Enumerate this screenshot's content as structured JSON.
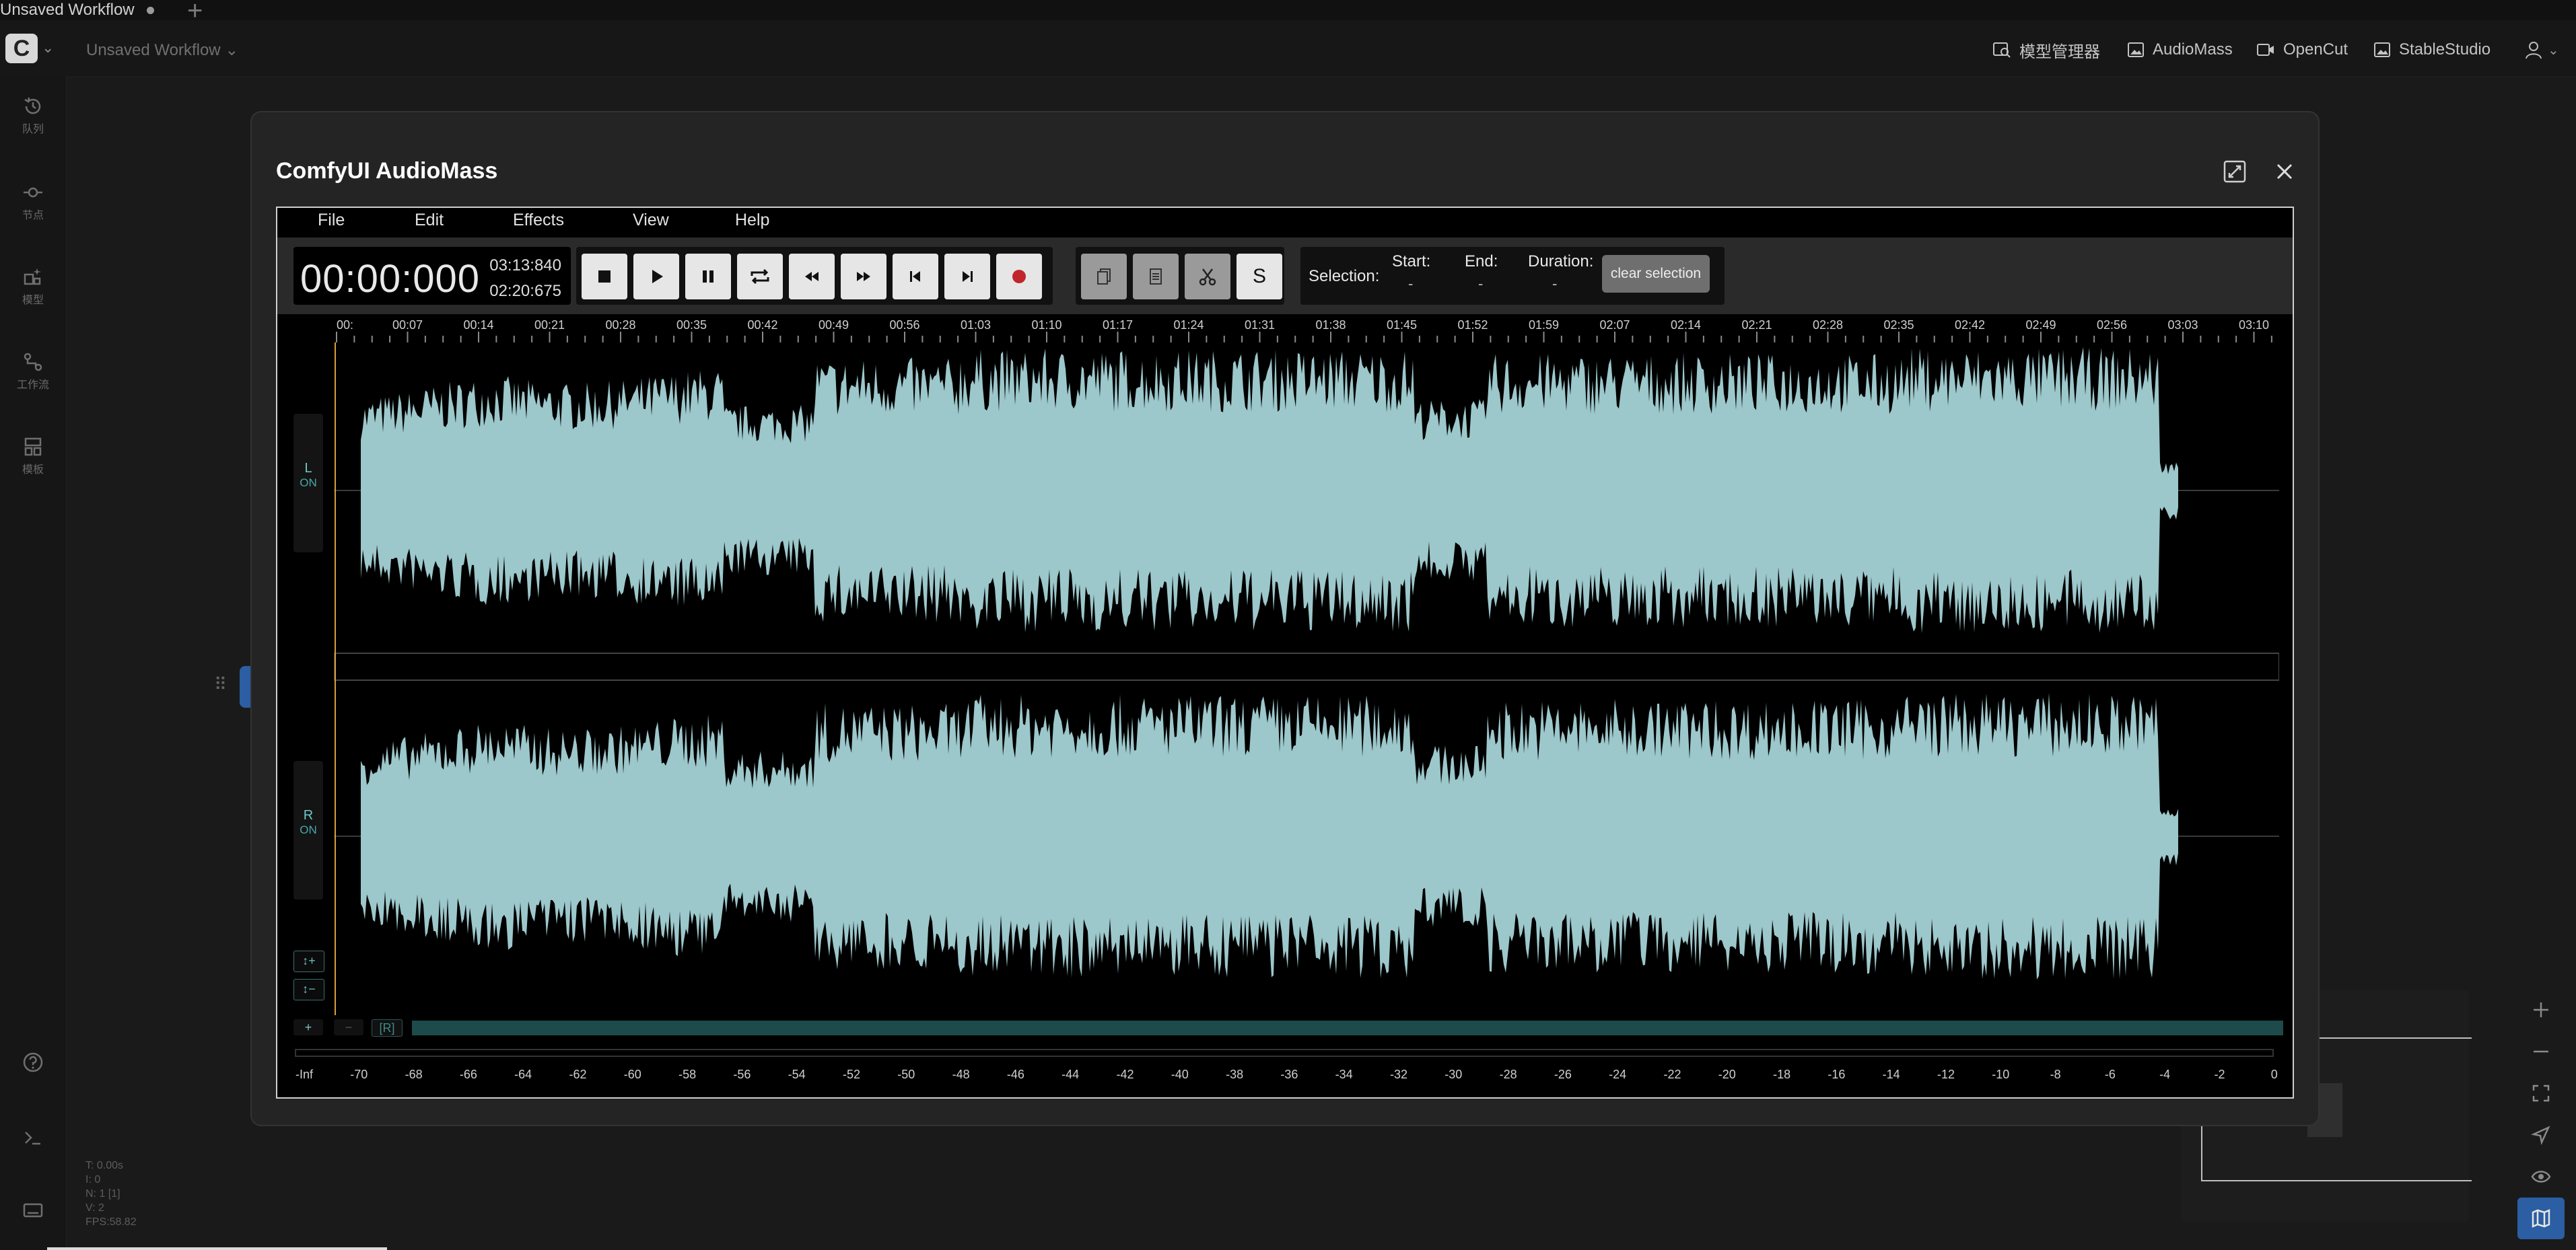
{
  "tab": {
    "title": "Unsaved Workflow",
    "new_tab": "+"
  },
  "header": {
    "logo": "C",
    "workflow_name": "Unsaved Workflow",
    "buttons": [
      {
        "label": "模型管理器",
        "icon": "model-manager-icon"
      },
      {
        "label": "AudioMass",
        "icon": "image-icon"
      },
      {
        "label": "OpenCut",
        "icon": "video-icon"
      },
      {
        "label": "StableStudio",
        "icon": "image-icon"
      }
    ]
  },
  "sidebar": {
    "items": [
      {
        "label": "队列",
        "icon": "history-icon"
      },
      {
        "label": "节点",
        "icon": "node-icon"
      },
      {
        "label": "模型",
        "icon": "model-icon"
      },
      {
        "label": "工作流",
        "icon": "workflow-icon"
      },
      {
        "label": "模板",
        "icon": "template-icon"
      }
    ],
    "bottom_icons": [
      "help-icon",
      "terminal-icon",
      "keyboard-icon"
    ]
  },
  "stats": [
    "T: 0.00s",
    "I: 0",
    "N: 1 [1]",
    "V: 2",
    "FPS:58.82"
  ],
  "modal": {
    "title": "ComfyUI AudioMass",
    "menu": [
      "File",
      "Edit",
      "Effects",
      "View",
      "Help"
    ],
    "clock": {
      "main": "00:00:000",
      "total": "03:13:840",
      "position": "02:20:675"
    },
    "transport_icons": [
      "stop-icon",
      "play-icon",
      "pause-icon",
      "loop-icon",
      "rewind-icon",
      "fast-forward-icon",
      "skip-back-icon",
      "skip-forward-icon",
      "record-icon"
    ],
    "edit_tools": [
      "copy-icon",
      "paste-icon",
      "cut-icon",
      "S"
    ],
    "selection": {
      "label": "Selection:",
      "start_label": "Start:",
      "end_label": "End:",
      "duration_label": "Duration:",
      "start": "-",
      "end": "-",
      "duration": "-",
      "clear": "clear selection"
    },
    "timeline": [
      "00:",
      "00:07",
      "00:14",
      "00:21",
      "00:28",
      "00:35",
      "00:42",
      "00:49",
      "00:56",
      "01:03",
      "01:10",
      "01:17",
      "01:24",
      "01:31",
      "01:38",
      "01:45",
      "01:52",
      "01:59",
      "02:07",
      "02:14",
      "02:21",
      "02:28",
      "02:35",
      "02:42",
      "02:49",
      "02:56",
      "03:03",
      "03:10"
    ],
    "channels": [
      {
        "name": "L",
        "state": "ON"
      },
      {
        "name": "R",
        "state": "ON"
      }
    ],
    "zoom": {
      "in": "↕+",
      "out": "↕−"
    },
    "scroll": {
      "plus": "+",
      "minus": "−",
      "reset": "[R]"
    },
    "meter": [
      "-Inf",
      "-70",
      "-68",
      "-66",
      "-64",
      "-62",
      "-60",
      "-58",
      "-56",
      "-54",
      "-52",
      "-50",
      "-48",
      "-46",
      "-44",
      "-42",
      "-40",
      "-38",
      "-36",
      "-34",
      "-32",
      "-30",
      "-28",
      "-26",
      "-24",
      "-22",
      "-20",
      "-18",
      "-16",
      "-14",
      "-12",
      "-10",
      "-8",
      "-6",
      "-4",
      "-2",
      "0"
    ],
    "colors": {
      "waveform": "#9cc7cb",
      "accent": "#2b5ea3",
      "record": "#c0262b"
    }
  }
}
